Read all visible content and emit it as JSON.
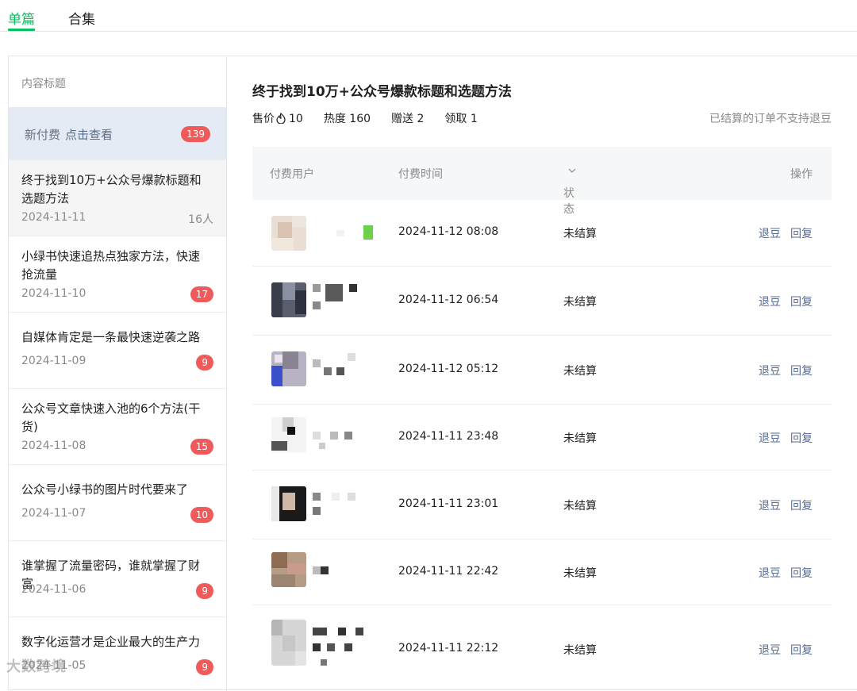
{
  "tabs": [
    {
      "label": "单篇",
      "active": true
    },
    {
      "label": "合集",
      "active": false
    }
  ],
  "sidebar": {
    "header": "内容标题",
    "new_pay": {
      "label": "新付费",
      "link": "点击查看",
      "badge": "139"
    },
    "items": [
      {
        "title": "终于找到10万+公众号爆款标题和选题方法",
        "date": "2024-11-11",
        "count": "16人"
      },
      {
        "title": "小绿书快速追热点独家方法，快速抢流量",
        "date": "2024-11-10",
        "badge": "17"
      },
      {
        "title": "自媒体肯定是一条最快速逆袭之路",
        "date": "2024-11-09",
        "badge": "9"
      },
      {
        "title": "公众号文章快速入池的6个方法(干货)",
        "date": "2024-11-08",
        "badge": "15"
      },
      {
        "title": "公众号小绿书的图片时代要来了",
        "date": "2024-11-07",
        "badge": "10"
      },
      {
        "title": "谁掌握了流量密码，谁就掌握了财富",
        "date": "2024-11-06",
        "badge": "9"
      },
      {
        "title": "数字化运营才是企业最大的生产力",
        "date": "2024-11-05",
        "badge": "9"
      }
    ]
  },
  "article": {
    "title": "终于找到10万+公众号爆款标题和选题方法",
    "price_label": "售价",
    "price_value": "10",
    "heat_label": "热度",
    "heat_value": "160",
    "gift_label": "赠送",
    "gift_value": "2",
    "claim_label": "领取",
    "claim_value": "1",
    "note": "已结算的订单不支持退豆"
  },
  "table": {
    "headers": {
      "user": "付费用户",
      "time": "付费时间",
      "status": "状态",
      "action": "操作"
    },
    "rows": [
      {
        "time": "2024-11-12 08:08",
        "status": "未结算",
        "refund": "退豆",
        "reply": "回复"
      },
      {
        "time": "2024-11-12 06:54",
        "status": "未结算",
        "refund": "退豆",
        "reply": "回复"
      },
      {
        "time": "2024-11-12 05:12",
        "status": "未结算",
        "refund": "退豆",
        "reply": "回复"
      },
      {
        "time": "2024-11-11 23:48",
        "status": "未结算",
        "refund": "退豆",
        "reply": "回复"
      },
      {
        "time": "2024-11-11 23:01",
        "status": "未结算",
        "refund": "退豆",
        "reply": "回复"
      },
      {
        "time": "2024-11-11 22:42",
        "status": "未结算",
        "refund": "退豆",
        "reply": "回复"
      },
      {
        "time": "2024-11-11 22:12",
        "status": "未结算",
        "refund": "退豆",
        "reply": "回复"
      }
    ]
  },
  "watermark": "大数跨境",
  "colors": {
    "accent": "#07c160",
    "link": "#576b95",
    "badge": "#f05a5a",
    "highlight": "#e4ebf5"
  }
}
